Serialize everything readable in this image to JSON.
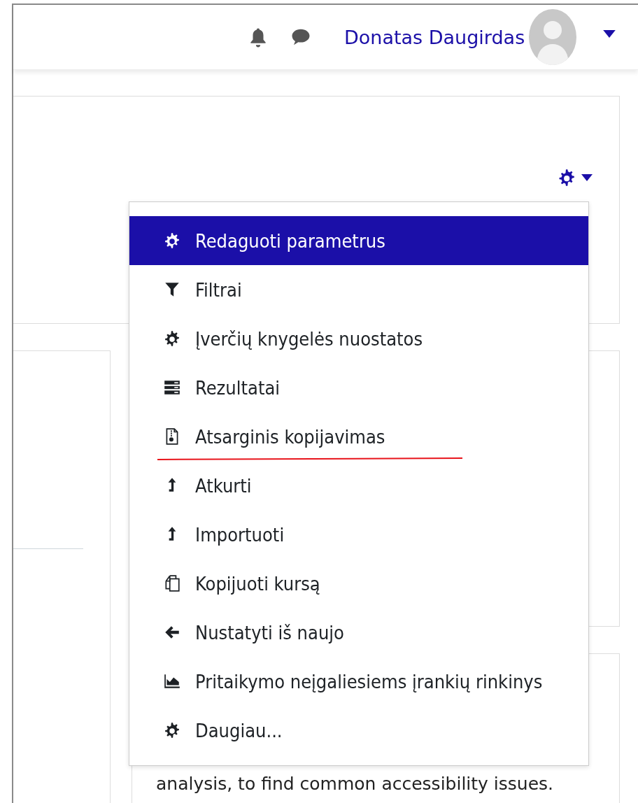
{
  "header": {
    "user_name": "Donatas Daugirdas"
  },
  "menu": {
    "items": [
      {
        "label": "Redaguoti parametrus",
        "kind": "gear",
        "selected": true,
        "underlined": false
      },
      {
        "label": "Filtrai",
        "kind": "filter",
        "selected": false,
        "underlined": false
      },
      {
        "label": "Įverčių knygelės nuostatos",
        "kind": "gear",
        "selected": false,
        "underlined": false
      },
      {
        "label": "Rezultatai",
        "kind": "table",
        "selected": false,
        "underlined": false
      },
      {
        "label": "Atsarginis kopijavimas",
        "kind": "archive",
        "selected": false,
        "underlined": true
      },
      {
        "label": "Atkurti",
        "kind": "upload",
        "selected": false,
        "underlined": false
      },
      {
        "label": "Importuoti",
        "kind": "upload",
        "selected": false,
        "underlined": false
      },
      {
        "label": "Kopijuoti kursą",
        "kind": "copy",
        "selected": false,
        "underlined": false
      },
      {
        "label": "Nustatyti iš naujo",
        "kind": "back",
        "selected": false,
        "underlined": false
      },
      {
        "label": "Pritaikymo neįgaliesiems įrankių rinkinys",
        "kind": "chart",
        "selected": false,
        "underlined": false
      },
      {
        "label": "Daugiau...",
        "kind": "gear",
        "selected": false,
        "underlined": false
      }
    ]
  },
  "accessibility_block": {
    "text": "analysis, to find common accessibility issues."
  }
}
